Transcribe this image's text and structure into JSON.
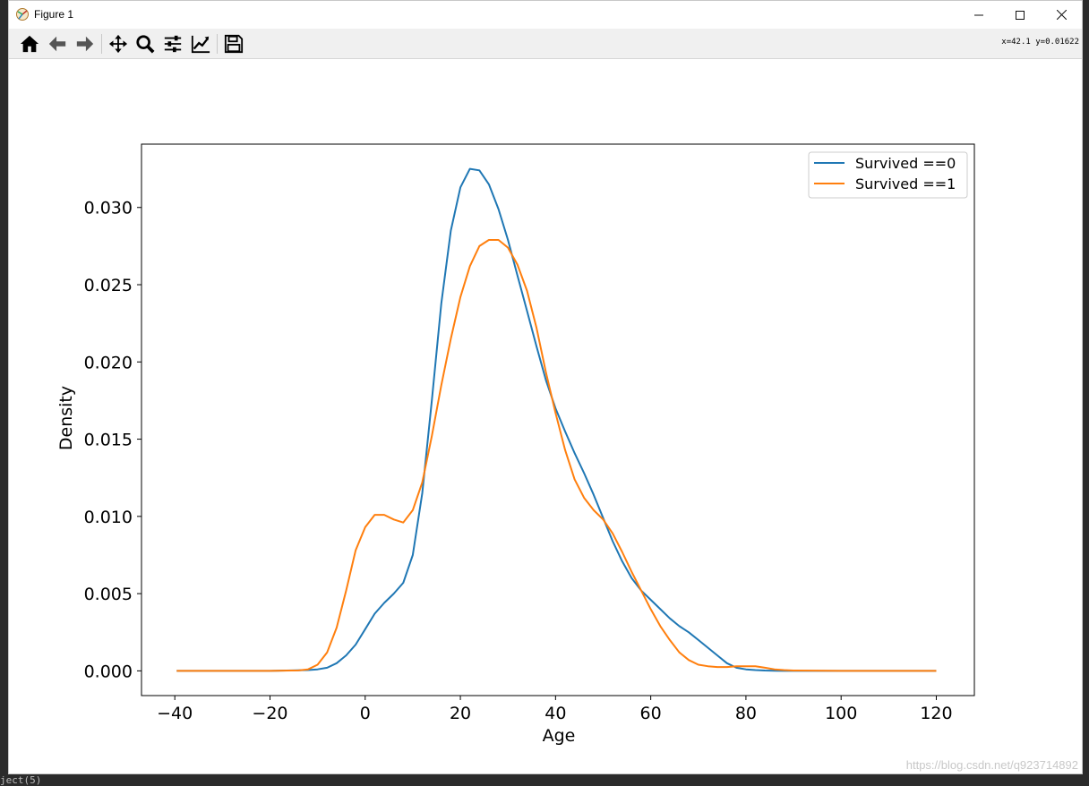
{
  "window": {
    "title": "Figure 1",
    "coord_readout": "x=42.1 y=0.01622",
    "watermark": "https://blog.csdn.net/q923714892",
    "console_fragment": "ject(5)"
  },
  "toolbar": {
    "buttons": [
      {
        "icon": "home-icon"
      },
      {
        "icon": "back-arrow-icon"
      },
      {
        "icon": "forward-arrow-icon"
      },
      {
        "icon": "pan-icon"
      },
      {
        "icon": "zoom-icon"
      },
      {
        "icon": "configure-subplots-icon"
      },
      {
        "icon": "edit-axis-icon"
      },
      {
        "icon": "save-icon"
      }
    ]
  },
  "chart_data": {
    "type": "line",
    "title": "",
    "xlabel": "Age",
    "ylabel": "Density",
    "xlim": [
      -47,
      128
    ],
    "ylim": [
      -0.0016,
      0.0341
    ],
    "xticks": [
      -40,
      -20,
      0,
      20,
      40,
      60,
      80,
      100,
      120
    ],
    "xtick_labels": [
      "−40",
      "−20",
      "0",
      "20",
      "40",
      "60",
      "80",
      "100",
      "120"
    ],
    "yticks": [
      0.0,
      0.005,
      0.01,
      0.015,
      0.02,
      0.025,
      0.03
    ],
    "ytick_labels": [
      "0.000",
      "0.005",
      "0.010",
      "0.015",
      "0.020",
      "0.025",
      "0.030"
    ],
    "grid": false,
    "legend": "top-right",
    "series": [
      {
        "name": "Survived ==0",
        "color": "#1f77b4",
        "x": [
          -39.6,
          -20,
          -12,
          -10,
          -8,
          -6,
          -4,
          -2,
          0,
          2,
          4,
          6,
          8,
          10,
          12,
          14,
          16,
          18,
          20,
          22,
          24,
          26,
          28,
          30,
          32,
          34,
          36,
          38,
          40,
          42,
          44,
          46,
          48,
          50,
          52,
          54,
          56,
          58,
          60,
          62,
          64,
          66,
          68,
          70,
          72,
          74,
          76,
          78,
          80,
          82,
          84,
          86,
          88,
          90,
          100,
          110,
          120
        ],
        "y": [
          0.0,
          0.0,
          5e-05,
          0.0001,
          0.0002,
          0.0005,
          0.001,
          0.0017,
          0.0027,
          0.0037,
          0.0044,
          0.005,
          0.0057,
          0.0075,
          0.0115,
          0.0175,
          0.0238,
          0.0285,
          0.0313,
          0.0325,
          0.0324,
          0.0315,
          0.0299,
          0.0279,
          0.0256,
          0.0233,
          0.021,
          0.0188,
          0.017,
          0.0155,
          0.0141,
          0.0128,
          0.0114,
          0.0099,
          0.0084,
          0.0071,
          0.006,
          0.0052,
          0.0046,
          0.004,
          0.0034,
          0.0029,
          0.0025,
          0.002,
          0.0015,
          0.001,
          0.0005,
          0.0002,
          0.0001,
          5e-05,
          2e-05,
          1e-05,
          0.0,
          0.0,
          0.0,
          0.0,
          0.0
        ]
      },
      {
        "name": "Survived ==1",
        "color": "#ff7f0e",
        "x": [
          -39.6,
          -20,
          -14,
          -12,
          -10,
          -8,
          -6,
          -4,
          -2,
          0,
          2,
          4,
          6,
          8,
          10,
          12,
          14,
          16,
          18,
          20,
          22,
          24,
          26,
          28,
          30,
          32,
          34,
          36,
          38,
          40,
          42,
          44,
          46,
          48,
          50,
          52,
          54,
          56,
          58,
          60,
          62,
          64,
          66,
          68,
          70,
          72,
          74,
          76,
          78,
          80,
          82,
          84,
          86,
          88,
          90,
          100,
          110,
          120
        ],
        "y": [
          0.0,
          0.0,
          3e-05,
          0.0001,
          0.0004,
          0.0012,
          0.0028,
          0.0052,
          0.0078,
          0.0093,
          0.0101,
          0.0101,
          0.0098,
          0.0096,
          0.0104,
          0.0122,
          0.0152,
          0.0185,
          0.0215,
          0.0242,
          0.0262,
          0.0275,
          0.0279,
          0.0279,
          0.0274,
          0.0263,
          0.0246,
          0.0222,
          0.0193,
          0.0167,
          0.0143,
          0.0124,
          0.0112,
          0.0104,
          0.0098,
          0.0089,
          0.0077,
          0.0064,
          0.0052,
          0.004,
          0.0029,
          0.002,
          0.0012,
          0.0007,
          0.0004,
          0.0003,
          0.00025,
          0.00025,
          0.0003,
          0.0003,
          0.0003,
          0.0002,
          0.0001,
          5e-05,
          2e-05,
          0.0,
          0.0,
          0.0
        ]
      }
    ]
  }
}
